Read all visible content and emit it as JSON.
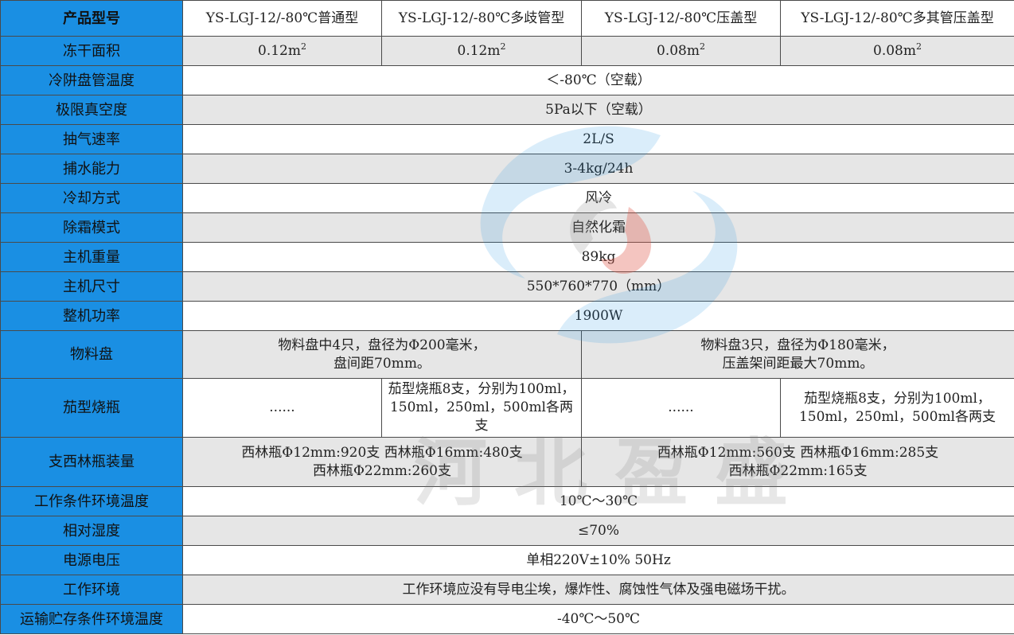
{
  "header": {
    "label": "产品型号",
    "models": [
      "YS-LGJ-12/-80℃普通型",
      "YS-LGJ-12/-80℃多歧管型",
      "YS-LGJ-12/-80℃压盖型",
      "YS-LGJ-12/-80℃多其管压盖型"
    ]
  },
  "freeze_area": {
    "label": "冻干面积",
    "values": [
      "0.12m",
      "0.12m",
      "0.08m",
      "0.08m"
    ],
    "sup": "2"
  },
  "rows1": [
    {
      "label": "冷阱盘管温度",
      "value": "＜-80℃（空载）"
    },
    {
      "label": "极限真空度",
      "value": "5Pa以下（空载）"
    },
    {
      "label": "抽气速率",
      "value": "2L/S"
    },
    {
      "label": "捕水能力",
      "value": "3-4kg/24h"
    },
    {
      "label": "冷却方式",
      "value": "风冷"
    },
    {
      "label": "除霜模式",
      "value": "自然化霜"
    },
    {
      "label": "主机重量",
      "value": "89kg"
    },
    {
      "label": "主机尺寸",
      "value": "550*760*770（mm）"
    },
    {
      "label": "整机功率",
      "value": "1900W"
    }
  ],
  "tray": {
    "label": "物料盘",
    "left_line1": "物料盘中4只，盘径为Φ200毫米，",
    "left_line2": "盘间距70mm。",
    "right_line1": "物料盘3只，盘径为Φ180毫米，",
    "right_line2": "压盖架间距最大70mm。"
  },
  "flask": {
    "label": "茄型烧瓶",
    "c1": "......",
    "c2_line1": "茄型烧瓶8支，分别为100ml，",
    "c2_line2": "150ml，250ml，500ml各两支",
    "c3": "......",
    "c4_line1": "茄型烧瓶8支，分别为100ml，",
    "c4_line2": "150ml，250ml，500ml各两支"
  },
  "vial": {
    "label": "支西林瓶装量",
    "left_line1": "西林瓶Φ12mm:920支 西林瓶Φ16mm:480支",
    "left_line2": "西林瓶Φ22mm:260支",
    "right_line1": "西林瓶Φ12mm:560支 西林瓶Φ16mm:285支",
    "right_line2": "西林瓶Φ22mm:165支"
  },
  "rows2": [
    {
      "label": "工作条件环境温度",
      "value": "10℃～30℃"
    },
    {
      "label": "相对湿度",
      "value": "≤70%"
    },
    {
      "label": "电源电压",
      "value": "单相220V±10% 50Hz"
    },
    {
      "label": "工作环境",
      "value": "工作环境应没有导电尘埃，爆炸性、腐蚀性气体及强电磁场干扰。"
    },
    {
      "label": "运输贮存条件环境温度",
      "value": "-40℃～50℃"
    }
  ],
  "watermark": {
    "text": "河北盈盛",
    "colors": {
      "blue": "#1a8fe3",
      "red": "#e05a4a",
      "gray": "#bfbfbf"
    }
  }
}
